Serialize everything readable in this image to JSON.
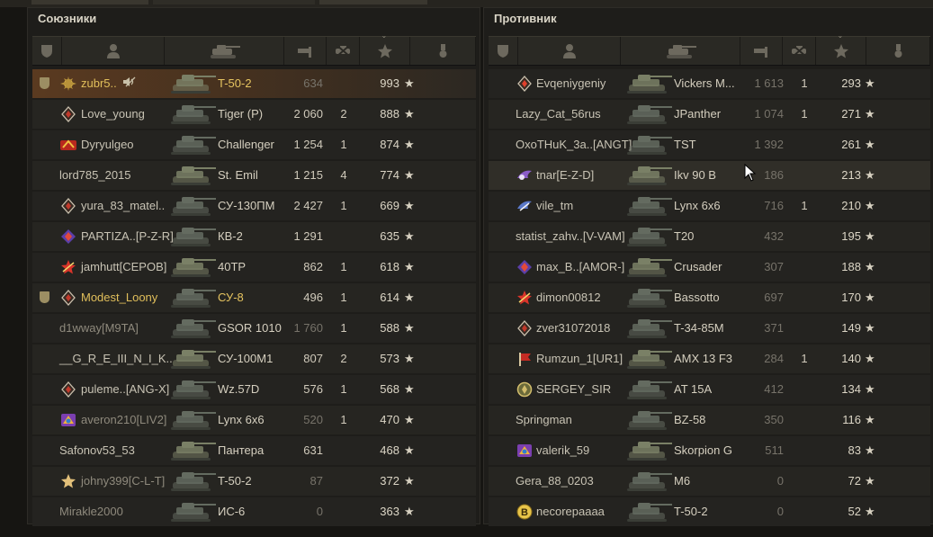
{
  "colors": {
    "accent_gold": "#e1bf5b",
    "self_row": "#5a3a20",
    "background": "#161512"
  },
  "header_icons": [
    "platoon-icon",
    "player-icon",
    "vehicle-icon",
    "damage-icon",
    "frags-icon",
    "xp-icon",
    "medal-icon"
  ],
  "sort_column": "xp",
  "allies": {
    "title": "Союзники",
    "rows": [
      {
        "squad": true,
        "badge": "sun-rank-icon",
        "name": "zubr5..",
        "vehicle": "T-50-2",
        "damage": "634",
        "frags": "",
        "xp": "993",
        "self": true,
        "voice": true
      },
      {
        "squad": false,
        "badge": "diamond-badge-icon",
        "name": "Love_young",
        "vehicle": "Tiger (P)",
        "damage": "2 060",
        "frags": "2",
        "xp": "888"
      },
      {
        "squad": false,
        "badge": "red-clan-icon",
        "name": "Dyryulgeo",
        "vehicle": "Challenger",
        "damage": "1 254",
        "frags": "1",
        "xp": "874"
      },
      {
        "squad": false,
        "badge": "",
        "name": "lord785_2015",
        "vehicle": "St. Emil",
        "damage": "1 215",
        "frags": "4",
        "xp": "774"
      },
      {
        "squad": false,
        "badge": "diamond-badge-icon",
        "name": "yura_83_matel..",
        "vehicle": "СУ-130ПМ",
        "damage": "2 427",
        "frags": "1",
        "xp": "669"
      },
      {
        "squad": false,
        "badge": "purple-clan-icon",
        "name": "PARTIZA..[P-Z-R]",
        "vehicle": "КВ-2",
        "damage": "1 291",
        "frags": "",
        "xp": "635"
      },
      {
        "squad": false,
        "badge": "red-star-clan-icon",
        "name": "jamhutt[CEPOB]",
        "vehicle": "40TP",
        "damage": "862",
        "frags": "1",
        "xp": "618"
      },
      {
        "squad": true,
        "badge": "diamond-badge-icon",
        "name": "Modest_Loony",
        "vehicle": "СУ-8",
        "damage": "496",
        "frags": "1",
        "xp": "614",
        "gold": true
      },
      {
        "squad": false,
        "badge": "",
        "name": "d1wway[M9TA]",
        "vehicle": "GSOR 1010",
        "damage": "1 760",
        "frags": "1",
        "xp": "588",
        "destroyed": true
      },
      {
        "squad": false,
        "badge": "",
        "name": "__G_R_E_III_N_I_K..",
        "vehicle": "СУ-100М1",
        "damage": "807",
        "frags": "2",
        "xp": "573"
      },
      {
        "squad": false,
        "badge": "diamond-badge-icon",
        "name": "puleme..[ANG-X]",
        "vehicle": "Wz.57D",
        "damage": "576",
        "frags": "1",
        "xp": "568"
      },
      {
        "squad": false,
        "badge": "multicolor-clan-icon",
        "name": "averon210[LIV2]",
        "vehicle": "Lynx 6x6",
        "damage": "520",
        "frags": "1",
        "xp": "470",
        "destroyed": true
      },
      {
        "squad": false,
        "badge": "",
        "name": "Safonov53_53",
        "vehicle": "Пантера",
        "damage": "631",
        "frags": "",
        "xp": "468"
      },
      {
        "squad": false,
        "badge": "gold-star-clan-icon",
        "name": "johny399[C-L-T]",
        "vehicle": "T-50-2",
        "damage": "87",
        "frags": "",
        "xp": "372",
        "destroyed": true
      },
      {
        "squad": false,
        "badge": "",
        "name": "Mirakle2000",
        "vehicle": "ИС-6",
        "damage": "0",
        "frags": "",
        "xp": "363",
        "destroyed": true
      }
    ]
  },
  "enemies": {
    "title": "Противник",
    "rows": [
      {
        "badge": "diamond-red-badge-icon",
        "name": "Evqeniygeniy",
        "vehicle": "Vickers M...",
        "damage": "1 613",
        "frags": "1",
        "xp": "293"
      },
      {
        "badge": "",
        "name": "Lazy_Cat_56rus",
        "vehicle": "JPanther",
        "damage": "1 074",
        "frags": "1",
        "xp": "271"
      },
      {
        "badge": "",
        "name": "OxoTHuK_3a..[ANGT]",
        "vehicle": "TST",
        "damage": "1 392",
        "frags": "",
        "xp": "261"
      },
      {
        "badge": "purple-wing-clan-icon",
        "name": "tnar[E-Z-D]",
        "vehicle": "Ikv 90 B",
        "damage": "186",
        "frags": "",
        "xp": "213",
        "highlight": true
      },
      {
        "badge": "blue-wing-clan-icon",
        "name": "vile_tm",
        "vehicle": "Lynx 6x6",
        "damage": "716",
        "frags": "1",
        "xp": "210"
      },
      {
        "badge": "",
        "name": "statist_zahv..[V-VAM]",
        "vehicle": "T20",
        "damage": "432",
        "frags": "",
        "xp": "195"
      },
      {
        "badge": "purple-clan-icon",
        "name": "max_B..[AMOR-]",
        "vehicle": "Crusader",
        "damage": "307",
        "frags": "",
        "xp": "188"
      },
      {
        "badge": "red-star-clan-icon",
        "name": "dimon00812",
        "vehicle": "Bassotto",
        "damage": "697",
        "frags": "",
        "xp": "170"
      },
      {
        "badge": "diamond-badge-icon",
        "name": "zver31072018",
        "vehicle": "T-34-85M",
        "damage": "371",
        "frags": "",
        "xp": "149"
      },
      {
        "badge": "red-flag-clan-icon",
        "name": "Rumzun_1[UR1]",
        "vehicle": "AMX 13 F3",
        "damage": "284",
        "frags": "1",
        "xp": "140"
      },
      {
        "badge": "laurel-clan-icon",
        "name": "SERGEY_SIR",
        "vehicle": "AT 15A",
        "damage": "412",
        "frags": "",
        "xp": "134"
      },
      {
        "badge": "",
        "name": "Springman",
        "vehicle": "BZ-58",
        "damage": "350",
        "frags": "",
        "xp": "116"
      },
      {
        "badge": "multicolor-clan-icon",
        "name": "valerik_59",
        "vehicle": "Skorpion G",
        "damage": "511",
        "frags": "",
        "xp": "83"
      },
      {
        "badge": "",
        "name": "Gera_88_0203",
        "vehicle": "M6",
        "damage": "0",
        "frags": "",
        "xp": "72"
      },
      {
        "badge": "b-coin-badge-icon",
        "name": "necorepaaaa",
        "vehicle": "T-50-2",
        "damage": "0",
        "frags": "",
        "xp": "52"
      }
    ]
  }
}
